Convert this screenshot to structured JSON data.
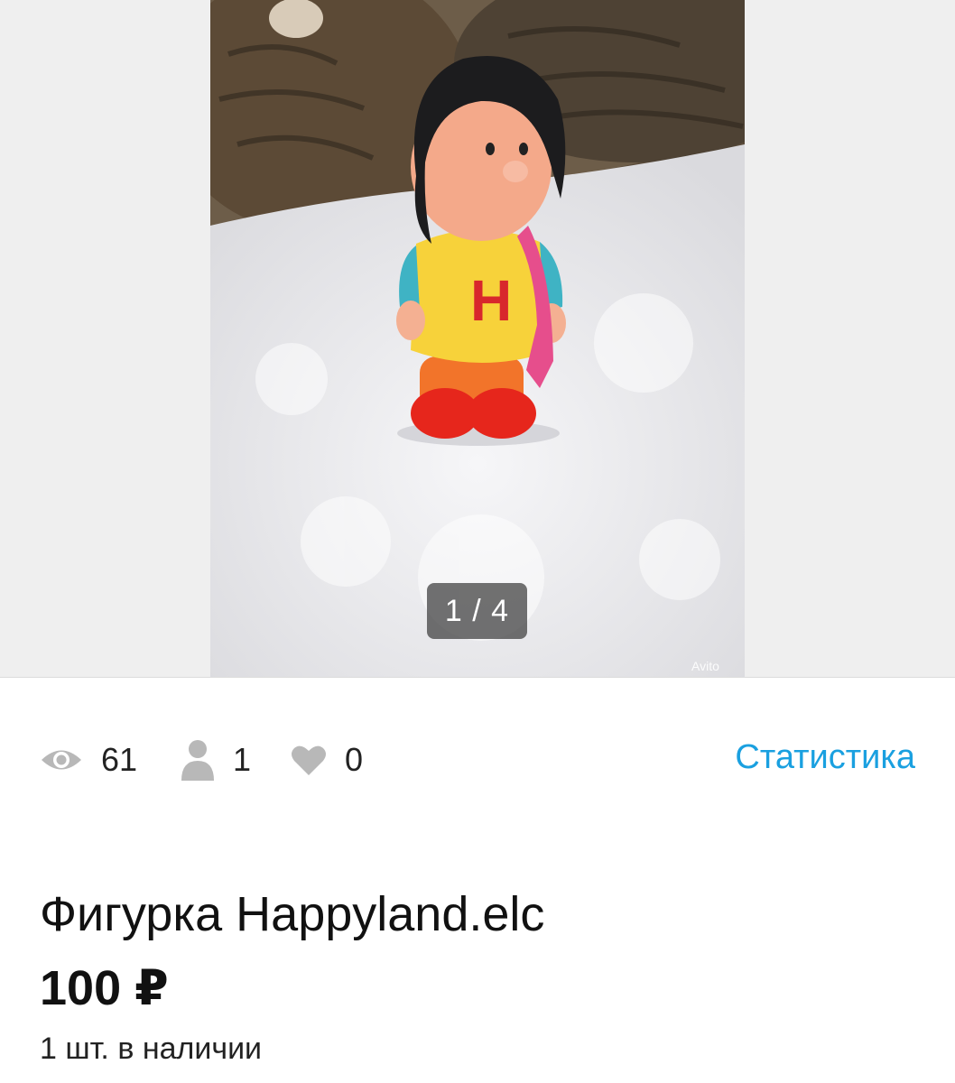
{
  "gallery": {
    "counter": "1 / 4",
    "watermark": "Avito"
  },
  "stats": {
    "views": "61",
    "contacts": "1",
    "favorites": "0",
    "link_label": "Статистика"
  },
  "listing": {
    "title": "Фигурка Happyland.elc",
    "price": "100 ₽",
    "stock": "1 шт. в наличии"
  }
}
